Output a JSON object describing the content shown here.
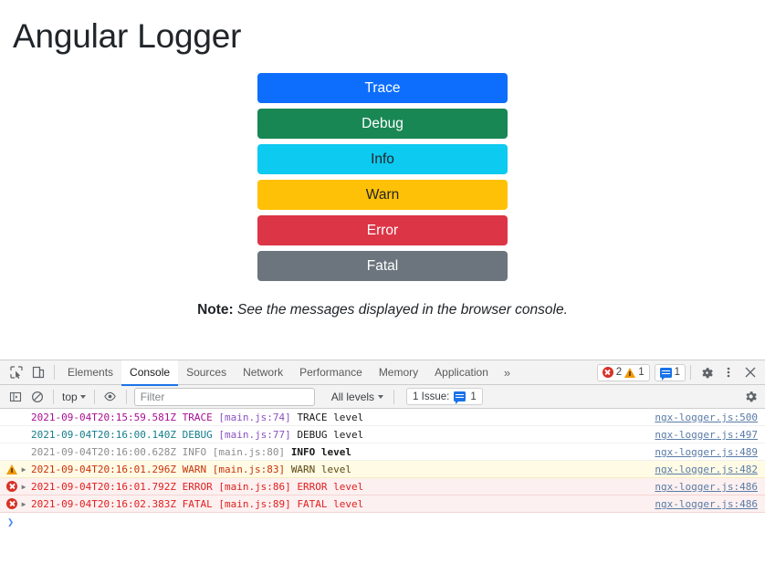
{
  "page": {
    "title": "Angular Logger",
    "buttons": [
      {
        "label": "Trace",
        "color": "#0d6efd",
        "text_color": "light"
      },
      {
        "label": "Debug",
        "color": "#198754",
        "text_color": "light"
      },
      {
        "label": "Info",
        "color": "#0dcaf0",
        "text_color": "dark"
      },
      {
        "label": "Warn",
        "color": "#ffc107",
        "text_color": "dark"
      },
      {
        "label": "Error",
        "color": "#dc3545",
        "text_color": "light"
      },
      {
        "label": "Fatal",
        "color": "#6c757d",
        "text_color": "light"
      }
    ],
    "note_label": "Note:",
    "note_text": "See the messages displayed in the browser console."
  },
  "devtools": {
    "tabs": [
      {
        "label": "Elements",
        "active": false
      },
      {
        "label": "Console",
        "active": true
      },
      {
        "label": "Sources",
        "active": false
      },
      {
        "label": "Network",
        "active": false
      },
      {
        "label": "Performance",
        "active": false
      },
      {
        "label": "Memory",
        "active": false
      },
      {
        "label": "Application",
        "active": false
      }
    ],
    "more_tabs_glyph": "»",
    "error_count": "2",
    "warning_count": "1",
    "message_count": "1",
    "toolbar": {
      "context": "top",
      "filter_placeholder": "Filter",
      "filter_value": "",
      "levels": "All levels",
      "issues_label": "1 Issue:",
      "issues_count": "1"
    },
    "console_rows": [
      {
        "severity": "trace",
        "timestamp": "2021-09-04T20:15:59.581Z",
        "level": "TRACE",
        "source": "[main.js:74]",
        "message": "TRACE level",
        "link": "ngx-logger.js:500",
        "expandable": false
      },
      {
        "severity": "debug",
        "timestamp": "2021-09-04T20:16:00.140Z",
        "level": "DEBUG",
        "source": "[main.js:77]",
        "message": "DEBUG level",
        "link": "ngx-logger.js:497",
        "expandable": false
      },
      {
        "severity": "info",
        "timestamp": "2021-09-04T20:16:00.628Z",
        "level": "INFO",
        "source": "[main.js:80]",
        "message": "INFO level",
        "link": "ngx-logger.js:489",
        "expandable": false
      },
      {
        "severity": "warn",
        "timestamp": "2021-09-04T20:16:01.296Z",
        "level": "WARN",
        "source": "[main.js:83]",
        "message": "WARN level",
        "link": "ngx-logger.js:482",
        "expandable": true
      },
      {
        "severity": "error",
        "timestamp": "2021-09-04T20:16:01.792Z",
        "level": "ERROR",
        "source": "[main.js:86]",
        "message": "ERROR level",
        "link": "ngx-logger.js:486",
        "expandable": true
      },
      {
        "severity": "error",
        "timestamp": "2021-09-04T20:16:02.383Z",
        "level": "FATAL",
        "source": "[main.js:89]",
        "message": "FATAL level",
        "link": "ngx-logger.js:486",
        "expandable": true
      }
    ],
    "prompt_glyph": "❯"
  }
}
